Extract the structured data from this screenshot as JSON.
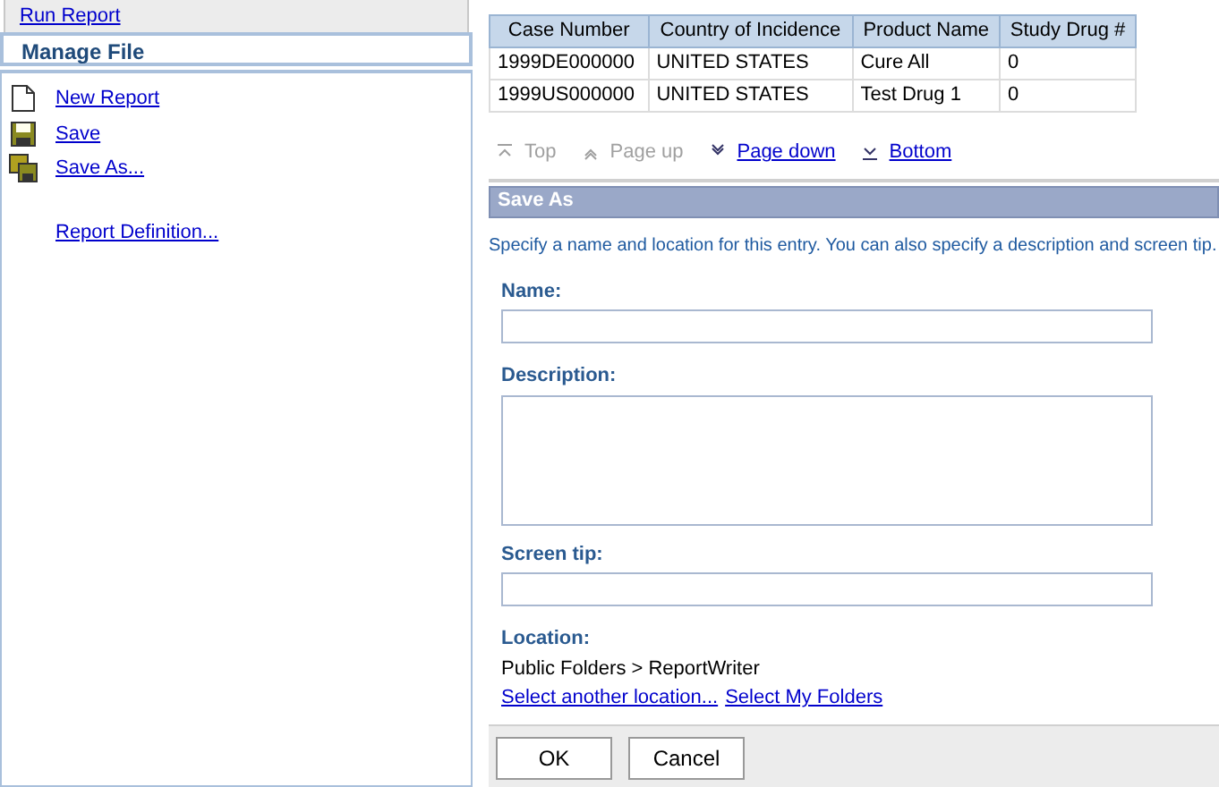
{
  "sidebar": {
    "sections": [
      {
        "label": "Run Report",
        "selected": false
      },
      {
        "label": "Manage File",
        "selected": true
      }
    ],
    "items": [
      {
        "label": "New Report",
        "kind": "new"
      },
      {
        "label": "Save",
        "kind": "save"
      },
      {
        "label": "Save As...",
        "kind": "saveas"
      },
      {
        "label": "Report Definition...",
        "kind": "plain"
      }
    ]
  },
  "table": {
    "columns": [
      "Case Number",
      "Country of Incidence",
      "Product Name",
      "Study Drug #"
    ],
    "rows": [
      [
        "1999DE000000",
        "UNITED STATES",
        "Cure All",
        "0"
      ],
      [
        "1999US000000",
        "UNITED STATES",
        "Test Drug 1",
        "0"
      ]
    ]
  },
  "pager": [
    {
      "label": "Top",
      "kind": "top",
      "disabled": true
    },
    {
      "label": "Page up",
      "kind": "up",
      "disabled": true
    },
    {
      "label": "Page down",
      "kind": "down",
      "disabled": false
    },
    {
      "label": "Bottom",
      "kind": "bottom",
      "disabled": false
    }
  ],
  "dialog": {
    "title": "Save As",
    "intro": "Specify a name and location for this entry. You can also specify a description and screen tip.",
    "name_label": "Name:",
    "description_label": "Description:",
    "screen_tip_label": "Screen tip:",
    "location_label": "Location:",
    "location": "Public Folders > ReportWriter",
    "links": [
      "Select another location...",
      "Select My Folders"
    ],
    "buttons": [
      "OK",
      "Cancel"
    ]
  }
}
